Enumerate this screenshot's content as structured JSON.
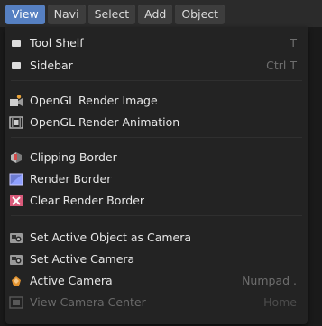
{
  "menubar": {
    "tabs": [
      {
        "label": "View",
        "active": true
      },
      {
        "label": "Navi"
      },
      {
        "label": "Select"
      },
      {
        "label": "Add"
      },
      {
        "label": "Object"
      }
    ]
  },
  "menu": {
    "items": [
      {
        "label": "Tool Shelf",
        "shortcut": "T",
        "icon": "panel-icon"
      },
      {
        "label": "Sidebar",
        "shortcut": "Ctrl T",
        "icon": "panel-icon"
      },
      {
        "label": "OpenGL Render Image",
        "shortcut": "",
        "icon": "render-still-icon"
      },
      {
        "label": "OpenGL Render Animation",
        "shortcut": "",
        "icon": "render-animation-icon"
      },
      {
        "label": "Clipping Border",
        "shortcut": "",
        "icon": "clipping-border-icon"
      },
      {
        "label": "Render Border",
        "shortcut": "",
        "icon": "render-border-icon"
      },
      {
        "label": "Clear Render Border",
        "shortcut": "",
        "icon": "clear-render-border-icon"
      },
      {
        "label": "Set Active Object as Camera",
        "shortcut": "",
        "icon": "camera-data-icon"
      },
      {
        "label": "Set Active Camera",
        "shortcut": "",
        "icon": "camera-data-icon"
      },
      {
        "label": "Active Camera",
        "shortcut": "Numpad .",
        "icon": "active-camera-icon"
      },
      {
        "label": "View Camera Center",
        "shortcut": "Home",
        "icon": "view-camera-center-icon",
        "disabled": true
      }
    ]
  },
  "colors": {
    "accent": "#5680c2",
    "menu_bg": "#232323",
    "bar_bg": "#2b2b2b",
    "text": "#e6e6e6",
    "shortcut": "#6e6e6e"
  }
}
